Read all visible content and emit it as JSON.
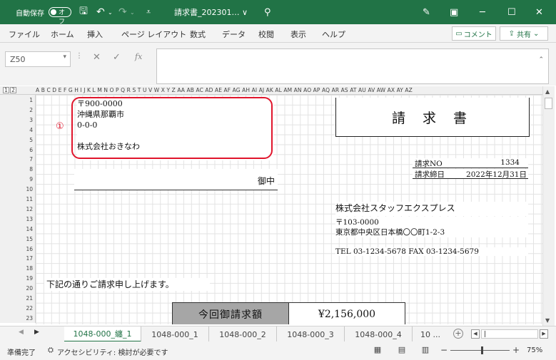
{
  "titlebar": {
    "autosave_label": "自動保存",
    "autosave_state": "オフ",
    "doc_title": "請求書_202301… ∨",
    "bg_color": "#217346"
  },
  "ribbon": {
    "tabs": [
      "ファイル",
      "ホーム",
      "挿入",
      "ページ レイアウト",
      "数式",
      "データ",
      "校閲",
      "表示",
      "ヘルプ"
    ],
    "comment_label": "コメント",
    "share_label": "共有"
  },
  "formula_bar": {
    "name_box": "Z50",
    "fx_symbol": "fx",
    "formula": ""
  },
  "grid": {
    "column_letters": "A B C D E F G H I J K L M N O P Q R S T U V W X Y Z AA AB AC AD AE AF AG AH AI AJ AK AL AM AN AO AP AQ AR AS AT AU AV AW AX AY AZ",
    "outline_levels": [
      "1",
      "2"
    ],
    "row_numbers": [
      "1",
      "2",
      "3",
      "4",
      "5",
      "6",
      "7",
      "8",
      "9",
      "10",
      "11",
      "12",
      "13",
      "14",
      "15",
      "16",
      "17",
      "18",
      "19",
      "20",
      "21",
      "22",
      "23"
    ]
  },
  "invoice": {
    "recipient": {
      "postal": "〒900-0000",
      "address1": "沖縄県那覇市",
      "address2": "0-0-0",
      "company": "株式会社おきなわ",
      "honorific": "御中"
    },
    "annotation_marker": "①",
    "title": "請 求 書",
    "invoice_no_label": "請求NO",
    "invoice_no": "1334",
    "closing_date_label": "請求締日",
    "closing_date": "2022年12月31日",
    "issuer": {
      "name": "株式会社スタッフエクスプレス",
      "postal": "〒103-0000",
      "address": "東京都中央区日本橋〇〇町1-2-3",
      "contact": "TEL 03-1234-5678 FAX 03-1234-5679"
    },
    "greeting": "下記の通りご請求申し上げます。",
    "amount_label": "今回御請求額",
    "amount_value": "¥2,156,000"
  },
  "sheet_tabs": {
    "tabs": [
      "1048-000_纏_1",
      "1048-000_1",
      "1048-000_2",
      "1048-000_3",
      "1048-000_4",
      "10 ..."
    ],
    "active_index": 0
  },
  "status": {
    "ready": "準備完了",
    "accessibility": "アクセシビリティ: 検討が必要です",
    "zoom": "75%"
  }
}
